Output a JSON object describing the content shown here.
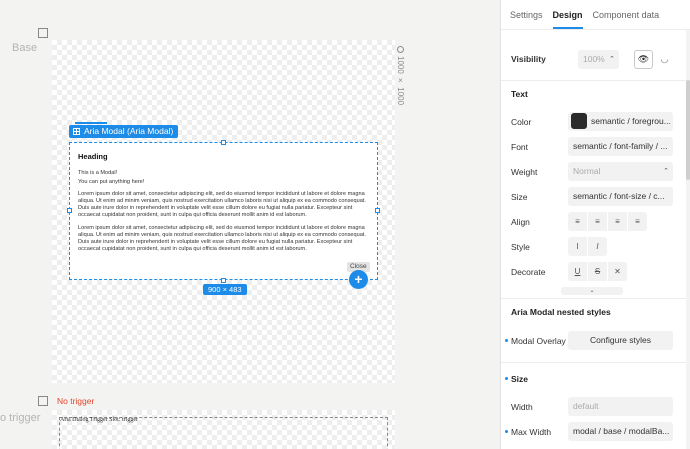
{
  "canvas": {
    "frame_base_label": "Base",
    "frame_trigger_label": "o trigger",
    "board_size": "1000 × 1000",
    "component_tag": "Aria Modal (Aria Modal)",
    "selection_size": "900 × 483",
    "close_tooltip": "Close",
    "add_button": "+",
    "no_trigger_label": "No trigger",
    "slot_label": "Aria Dialog Trigger Slot: trigger",
    "modal": {
      "heading": "Heading",
      "line1": "This is a Modal!",
      "line2": "You can put anything here!",
      "para1": "Lorem ipsum dolor sit amet, consectetur adipiscing elit, sed do eiusmod tempor incididunt ut labore et dolore magna aliqua. Ut enim ad minim veniam, quis nostrud exercitation ullamco laboris nisi ut aliquip ex ea commodo consequat. Duis aute irure dolor in reprehenderit in voluptate velit esse cillum dolore eu fugiat nulla pariatur. Excepteur sint occaecat cupidatat non proident, sunt in culpa qui officia deserunt mollit anim id est laborum.",
      "para2": "Lorem ipsum dolor sit amet, consectetur adipiscing elit, sed do eiusmod tempor incididunt ut labore et dolore magna aliqua. Ut enim ad minim veniam, quis nostrud exercitation ullamco laboris nisi ut aliquip ex ea commodo consequat. Duis aute irure dolor in reprehenderit in voluptate velit esse cillum dolore eu fugiat nulla pariatur. Excepteur sint occaecat cupidatat non proident, sunt in culpa qui officia deserunt mollit anim id est laborum."
    }
  },
  "panel": {
    "tabs": [
      "Settings",
      "Design",
      "Component data"
    ],
    "active_tab": "Design",
    "visibility": {
      "label": "Visibility",
      "opacity": "100%"
    },
    "text_section": {
      "title": "Text",
      "color_label": "Color",
      "color_value": "semantic / foregrou...",
      "font_label": "Font",
      "font_value": "semantic / font-family / ...",
      "weight_label": "Weight",
      "weight_value": "Normal",
      "size_label": "Size",
      "size_value": "semantic / font-size / c...",
      "align_label": "Align",
      "style_label": "Style",
      "decorate_label": "Decorate"
    },
    "nested_section": {
      "title": "Aria Modal nested styles",
      "overlay_label": "Modal Overlay",
      "configure_button": "Configure styles"
    },
    "size_section": {
      "title": "Size",
      "width_label": "Width",
      "width_placeholder": "default",
      "max_width_label": "Max Width",
      "max_width_value": "modal / base / modalBa..."
    }
  },
  "colors": {
    "accent": "#1d8be8",
    "error": "#e0462a",
    "swatch": "#2a2a2a"
  }
}
